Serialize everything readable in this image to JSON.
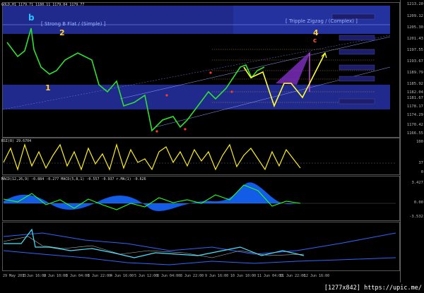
{
  "header": {
    "title": "GOLD,H1  1179.71 1180.11 1179.04 1179.77"
  },
  "price_axis": [
    "1213.20",
    "1209.12",
    "1205.30",
    "1201.43",
    "1197.55",
    "1193.67",
    "1189.79",
    "1185.92",
    "1182.04",
    "1181.67",
    "1178.17",
    "1174.29",
    "1170.42",
    "1166.55"
  ],
  "wave_labels": {
    "strong_b_flat": "[ Strong B Flat / (Simple) ]",
    "tripple_zigzag": "[ Tripple Zigzag / (Complex) ]",
    "wave_b": "b",
    "wave_2": "2",
    "wave_1": "1",
    "wave_4": "4",
    "wave_c": "c"
  },
  "rsi": {
    "title": "RSI(8) 29.6704",
    "scale": [
      "100",
      "37",
      "0"
    ]
  },
  "macd": {
    "title": "MACD(12,26,9) -0.884 -0.277  MACD(5,8,1) -0.557 -0.937  r.MA(1) -0.626",
    "scale": [
      "3.427",
      "0.00",
      "-3.532"
    ]
  },
  "time_axis": [
    "29 May 2015",
    "1 Jun 16:00",
    "2 Jun 10:00",
    "3 Jun 04:00",
    "3 Jun 22:00",
    "4 Jun 16:00",
    "5 Jun 12:00",
    "8 Jun 04:00",
    "8 Jun 22:00",
    "9 Jun 16:00",
    "10 Jun 10:00",
    "11 Jun 04:00",
    "11 Jun 22:00",
    "12 Jun 16:00"
  ],
  "watermark": "[1277x842] https://upic.me/"
}
